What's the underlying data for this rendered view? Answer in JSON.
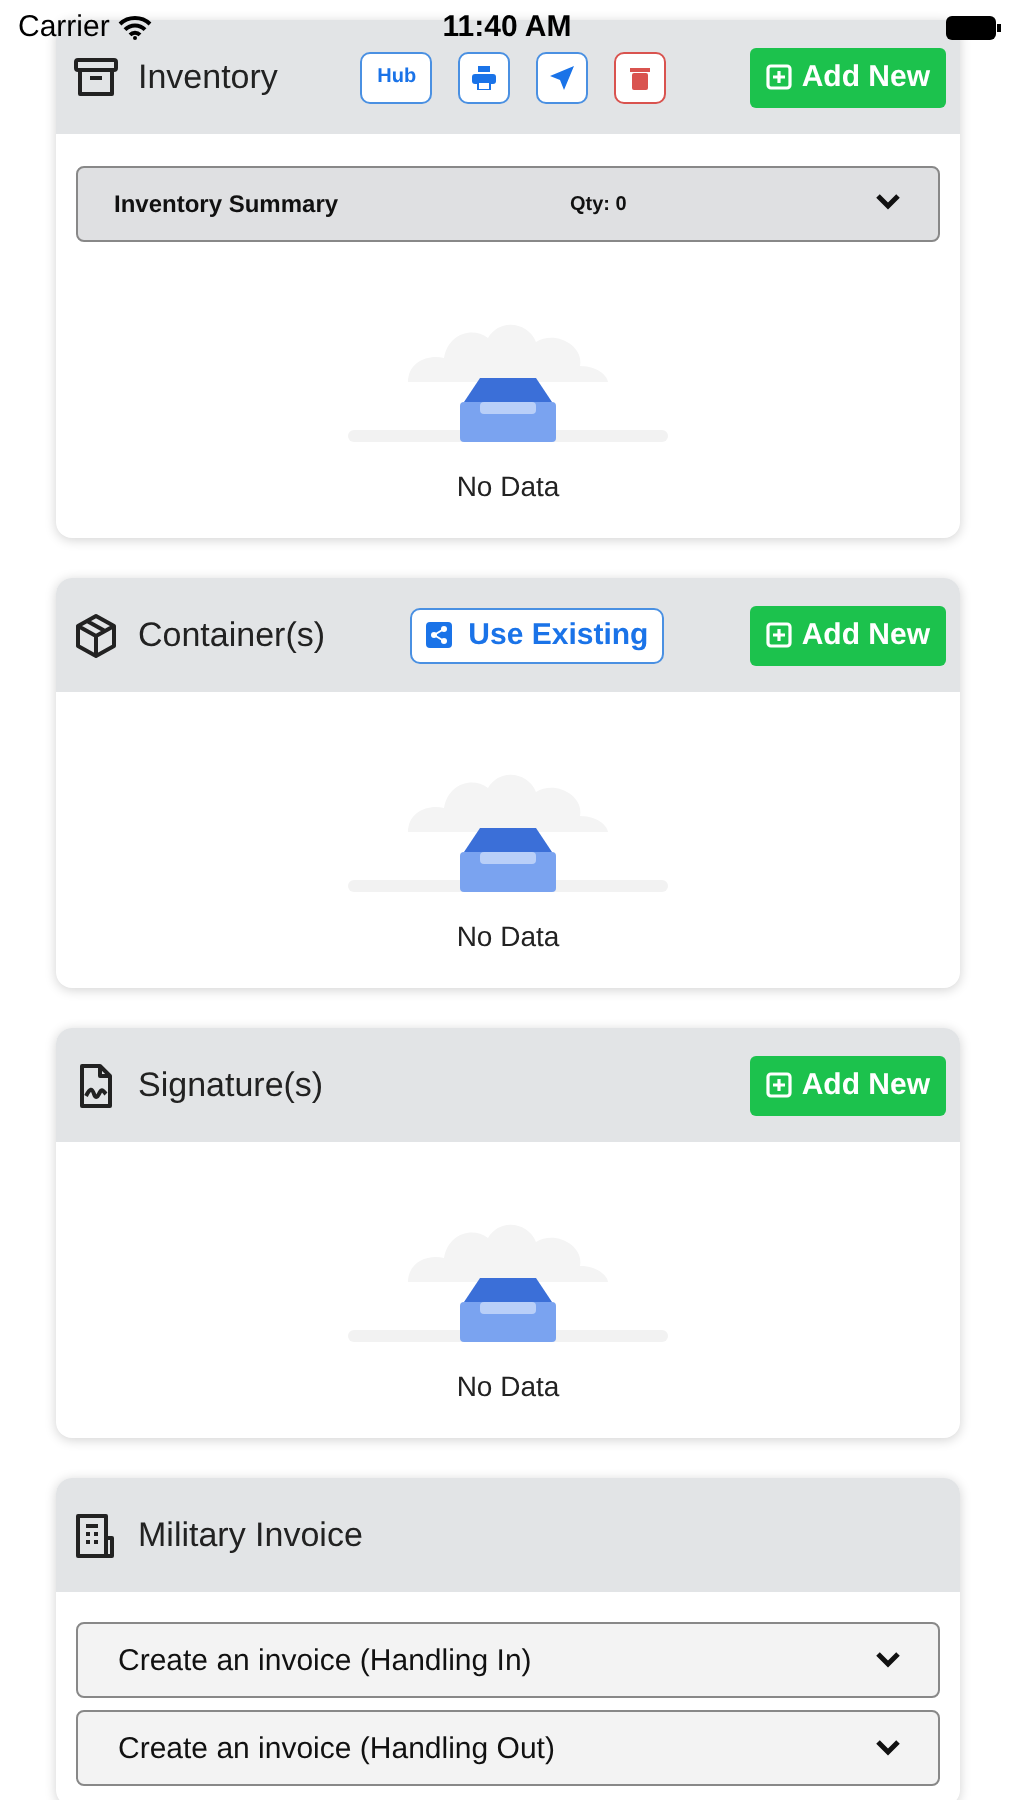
{
  "status_bar": {
    "carrier": "Carrier",
    "time": "11:40 AM"
  },
  "sections": [
    {
      "kind": "inventory",
      "title": "Inventory",
      "actions": [
        {
          "kind": "hub",
          "label": "Hub"
        },
        {
          "kind": "print"
        },
        {
          "kind": "send"
        },
        {
          "kind": "delete"
        },
        {
          "kind": "add_new",
          "label": "Add New"
        }
      ],
      "summary": {
        "label": "Inventory Summary",
        "qty": "Qty: 0",
        "expanded": false
      },
      "empty_text": "No Data"
    },
    {
      "kind": "container",
      "title": "Container(s)",
      "actions": [
        {
          "kind": "use_existing",
          "label": "Use Existing"
        },
        {
          "kind": "add_new",
          "label": "Add New"
        }
      ],
      "empty_text": "No Data"
    },
    {
      "kind": "signature",
      "title": "Signature(s)",
      "actions": [
        {
          "kind": "add_new",
          "label": "Add New"
        }
      ],
      "empty_text": "No Data"
    },
    {
      "kind": "invoice",
      "title": "Military Invoice",
      "accordions": [
        {
          "label": "Create an invoice (Handling In)",
          "expanded": false
        },
        {
          "label": "Create an invoice (Handling Out)",
          "expanded": false
        }
      ]
    }
  ]
}
